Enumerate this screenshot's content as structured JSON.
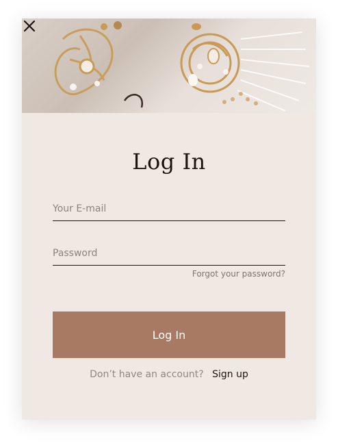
{
  "modal": {
    "title": "Log In",
    "email": {
      "placeholder": "Your E-mail",
      "value": ""
    },
    "password": {
      "placeholder": "Password",
      "value": ""
    },
    "forgot_label": "Forgot your password?",
    "submit_label": "Log In",
    "signup_prompt": "Don’t have an account?",
    "signup_link": "Sign up"
  },
  "icons": {
    "close": "close-icon"
  },
  "colors": {
    "modal_bg": "#f0e8e3",
    "button_bg": "#a97a63",
    "button_text": "#ffffff",
    "title_text": "#1d1410"
  }
}
